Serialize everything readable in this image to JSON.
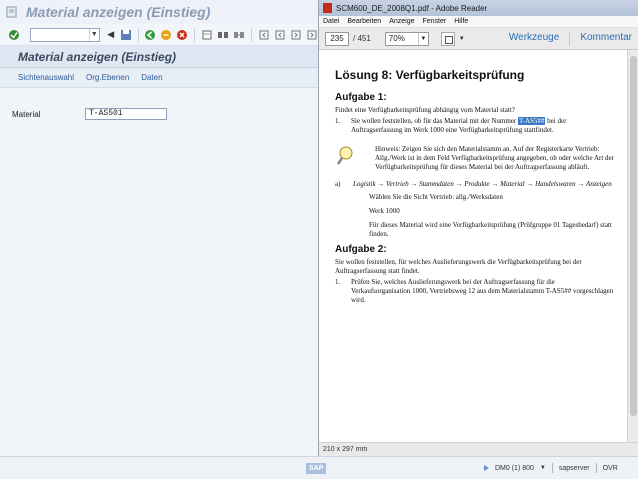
{
  "sap": {
    "window_title": "Material anzeigen (Einstieg)",
    "screen_title": "Material anzeigen (Einstieg)",
    "command_field_value": "",
    "app_toolbar": [
      "Sichtenauswahl",
      "Org.Ebenen",
      "Daten"
    ],
    "material_label": "Material",
    "material_value": "T-AS501",
    "status": {
      "system": "DM0 (1) 800",
      "server": "sapserver",
      "mode": "OVR",
      "logo": "SAP"
    }
  },
  "reader": {
    "window_title": "SCM600_DE_2008Q1.pdf - Adobe Reader",
    "menu": [
      "Datei",
      "Bearbeiten",
      "Anzeige",
      "Fenster",
      "Hilfe"
    ],
    "page_current": "235",
    "page_total": "/ 451",
    "zoom": "70%",
    "tools_label": "Werkzeuge",
    "comment_label": "Kommentar",
    "page_size": "210 x 297 mm",
    "page": {
      "heading": "Lösung 8: Verfügbarkeitsprüfung",
      "task1_title": "Aufgabe 1:",
      "task1_intro": "Findet eine Verfügbarkeitsprüfung abhängig vom Material statt?",
      "task1_item_num": "1.",
      "task1_item_before": "Sie wollen feststellen, ob für das Material mit der Nummer",
      "task1_item_highlight": "T-AS5##",
      "task1_item_after": "bei der Auftragserfassung im Werk 1000 eine Verfügbarkeitsprüfung stattfindet.",
      "hint_label": "Hinweis:",
      "hint_text": "Zeigen Sie sich den Materialstamm an. Auf der Registerkarte Vertrieb: Allg./Werk ist in dem Feld Verfügbarkeitsprüfung angegeben, ob oder welche Art der Verfügbarkeitsprüfung für dieses Material bei der Auftragserfassung abläuft.",
      "sub_a_num": "a)",
      "sub_a_path": "Logistik → Vertrieb → Stammdaten → Produkte → Material → Handelswaren → Anzeigen",
      "sub_a_view": "Wählen Sie die Sicht Vertrieb: allg./Werksdaten",
      "sub_a_plant": "Werk 1000",
      "sub_a_result": "Für dieses Material wird eine Verfügbarkeitsprüfung (Prüfgruppe 01 Tagesbedarf) statt finden.",
      "task2_title": "Aufgabe 2:",
      "task2_intro": "Sie wollen feststellen, für welches Auslieferungswerk die Verfügbarkeitsprüfung bei der Auftragserfassung statt findet.",
      "task2_item_num": "1.",
      "task2_item": "Prüfen Sie, welches Auslieferungswerk bei der Auftragserfassung für die Verkaufsorganisation 1000, Vertriebsweg 12 aus dem Materialstamm T-AS5## vorgeschlagen wird."
    }
  }
}
